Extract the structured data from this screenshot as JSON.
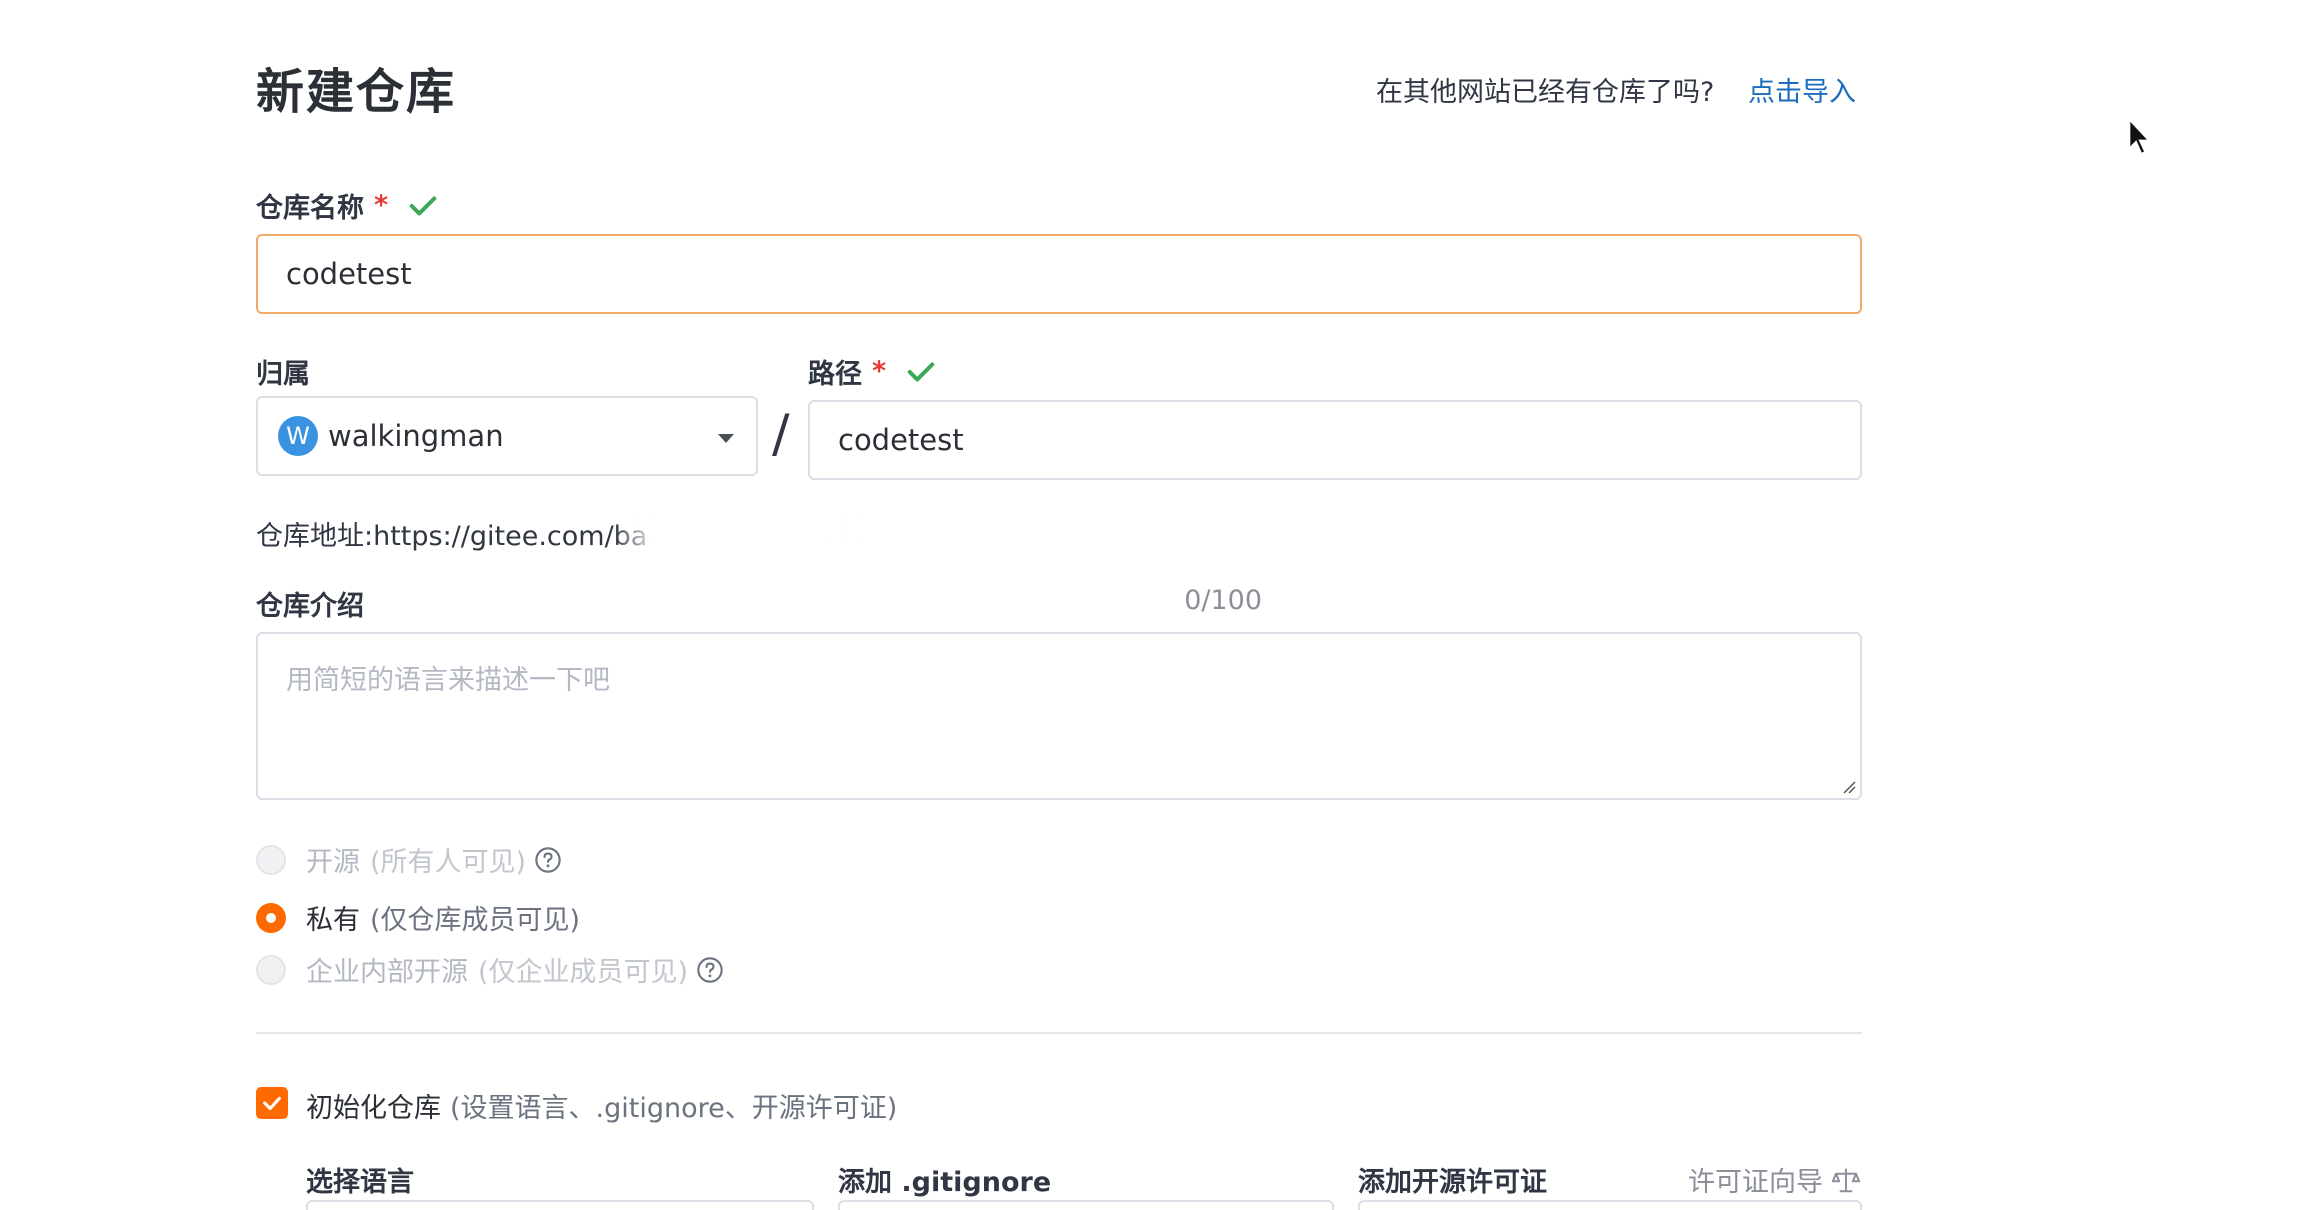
{
  "header": {
    "title": "新建仓库",
    "import_prompt": "在其他网站已经有仓库了吗?",
    "import_link": "点击导入"
  },
  "repo_name": {
    "label": "仓库名称",
    "required_mark": "*",
    "value": "codetest"
  },
  "owner": {
    "label": "归属",
    "avatar_letter": "W",
    "value": "walkingman"
  },
  "separator": "/",
  "path": {
    "label": "路径",
    "required_mark": "*",
    "value": "codetest"
  },
  "repo_url": {
    "text": "仓库地址:https://gitee.com/ba"
  },
  "description": {
    "label": "仓库介绍",
    "counter": "0/100",
    "placeholder": "用简短的语言来描述一下吧"
  },
  "visibility": {
    "options": [
      {
        "label": "开源",
        "sub": "(所有人可见)",
        "state": "disabled",
        "help": true
      },
      {
        "label": "私有",
        "sub": "(仅仓库成员可见)",
        "state": "checked",
        "help": false
      },
      {
        "label": "企业内部开源",
        "sub": "(仅企业成员可见)",
        "state": "disabled",
        "help": true
      }
    ]
  },
  "init": {
    "label": "初始化仓库",
    "sub": "(设置语言、.gitignore、开源许可证)",
    "checked": true
  },
  "init_options": {
    "language_label": "选择语言",
    "gitignore_label": "添加 .gitignore",
    "license_label": "添加开源许可证",
    "license_wizard": "许可证向导"
  },
  "colors": {
    "accent": "#ff6a00",
    "link": "#1a6dbe",
    "success": "#3aa757",
    "required": "#e53935"
  },
  "icons": {
    "valid": "check-icon",
    "help": "question-circle-icon",
    "wizard": "scale-icon",
    "cursor": "mouse-pointer-icon"
  }
}
